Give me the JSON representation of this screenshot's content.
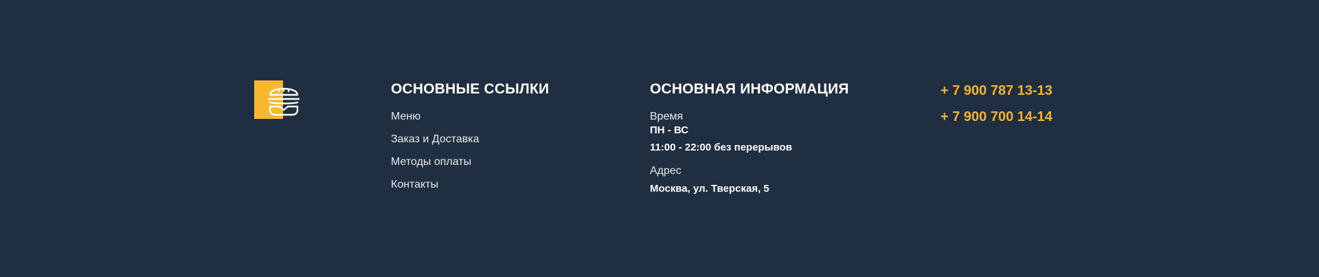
{
  "logo": {
    "icon": "burger-icon",
    "accent_color": "#f8b731"
  },
  "links_section": {
    "title": "ОСНОВНЫЕ ССЫЛКИ",
    "items": [
      {
        "label": "Меню"
      },
      {
        "label": "Заказ и Доставка"
      },
      {
        "label": "Методы оплаты"
      },
      {
        "label": "Контакты"
      }
    ]
  },
  "info_section": {
    "title": "ОСНОВНАЯ ИНФОРМАЦИЯ",
    "time_label": "Время",
    "days": "ПН - ВС",
    "hours": "11:00 - 22:00 без перерывов",
    "address_label": "Адрес",
    "address": "Москва, ул. Тверская, 5"
  },
  "contacts": {
    "phones": [
      "+ 7 900 787 13-13",
      "+ 7 900 700 14-14"
    ],
    "phone_color": "#f4b232"
  },
  "colors": {
    "background": "#1f2e40",
    "text": "#ffffff"
  }
}
